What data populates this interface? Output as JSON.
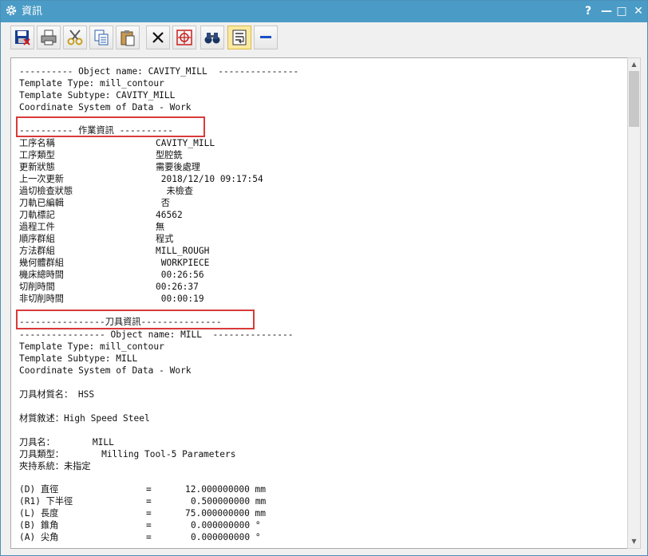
{
  "window": {
    "title": "資訊",
    "help": "?",
    "minimize": "—",
    "maximize": "□",
    "close": "✕"
  },
  "toolbar": {
    "icons": [
      "save-icon",
      "print-icon",
      "cut-icon",
      "copy-icon",
      "paste-icon",
      "delete-icon",
      "target-icon",
      "binoculars-icon",
      "wrap-text-icon",
      "minus-icon"
    ]
  },
  "text": {
    "op_header": "---------- Object name: CAVITY_MILL  ---------------",
    "op_template_type": "Template Type: mill_contour",
    "op_template_subtype": "Template Subtype: CAVITY_MILL",
    "op_coord": "Coordinate System of Data - Work",
    "section1_title": "---------- 作業資訊 ----------",
    "section1_rows": [
      {
        "label": "工序名稱",
        "value": "CAVITY_MILL"
      },
      {
        "label": "工序類型",
        "value": "型腔銑"
      },
      {
        "label": "更新狀態",
        "value": "需要後處理"
      },
      {
        "label": "上一次更新",
        "value": " 2018/12/10 09:17:54"
      },
      {
        "label": "過切檢查狀態",
        "value": "  未檢查"
      },
      {
        "label": "刀軌已編輯",
        "value": " 否"
      },
      {
        "label": "刀軌標記",
        "value": "46562"
      },
      {
        "label": "過程工件",
        "value": "無"
      },
      {
        "label": "順序群組",
        "value": "程式"
      },
      {
        "label": "方法群組",
        "value": "MILL_ROUGH"
      },
      {
        "label": "幾何體群組",
        "value": " WORKPIECE"
      },
      {
        "label": "機床總時間",
        "value": " 00:26:56"
      },
      {
        "label": "切削時間",
        "value": "00:26:37"
      },
      {
        "label": "非切削時間",
        "value": " 00:00:19"
      }
    ],
    "section2_title": "----------------刀具資訊---------------",
    "tool_header": "---------------- Object name: MILL  ---------------",
    "tool_template_type": "Template Type: mill_contour",
    "tool_template_subtype": "Template Subtype: MILL",
    "tool_coord": "Coordinate System of Data - Work",
    "tool_material": "刀具材質名： HSS",
    "material_desc": "材質敘述：High Speed Steel",
    "tool_name": "刀具名：       MILL",
    "tool_type": "刀具類型：       Milling Tool-5 Parameters",
    "holder": "夾持系統：未指定",
    "params": [
      {
        "label": "(D) 直徑",
        "eq": "=",
        "value": "12.000000000 mm"
      },
      {
        "label": "(R1) 下半徑",
        "eq": "=",
        "value": "0.500000000 mm"
      },
      {
        "label": "(L) 長度",
        "eq": "=",
        "value": "75.000000000 mm"
      },
      {
        "label": "(B) 錐角",
        "eq": "=",
        "value": "0.000000000 °"
      },
      {
        "label": "(A) 尖角",
        "eq": "=",
        "value": "0.000000000 °"
      }
    ]
  }
}
